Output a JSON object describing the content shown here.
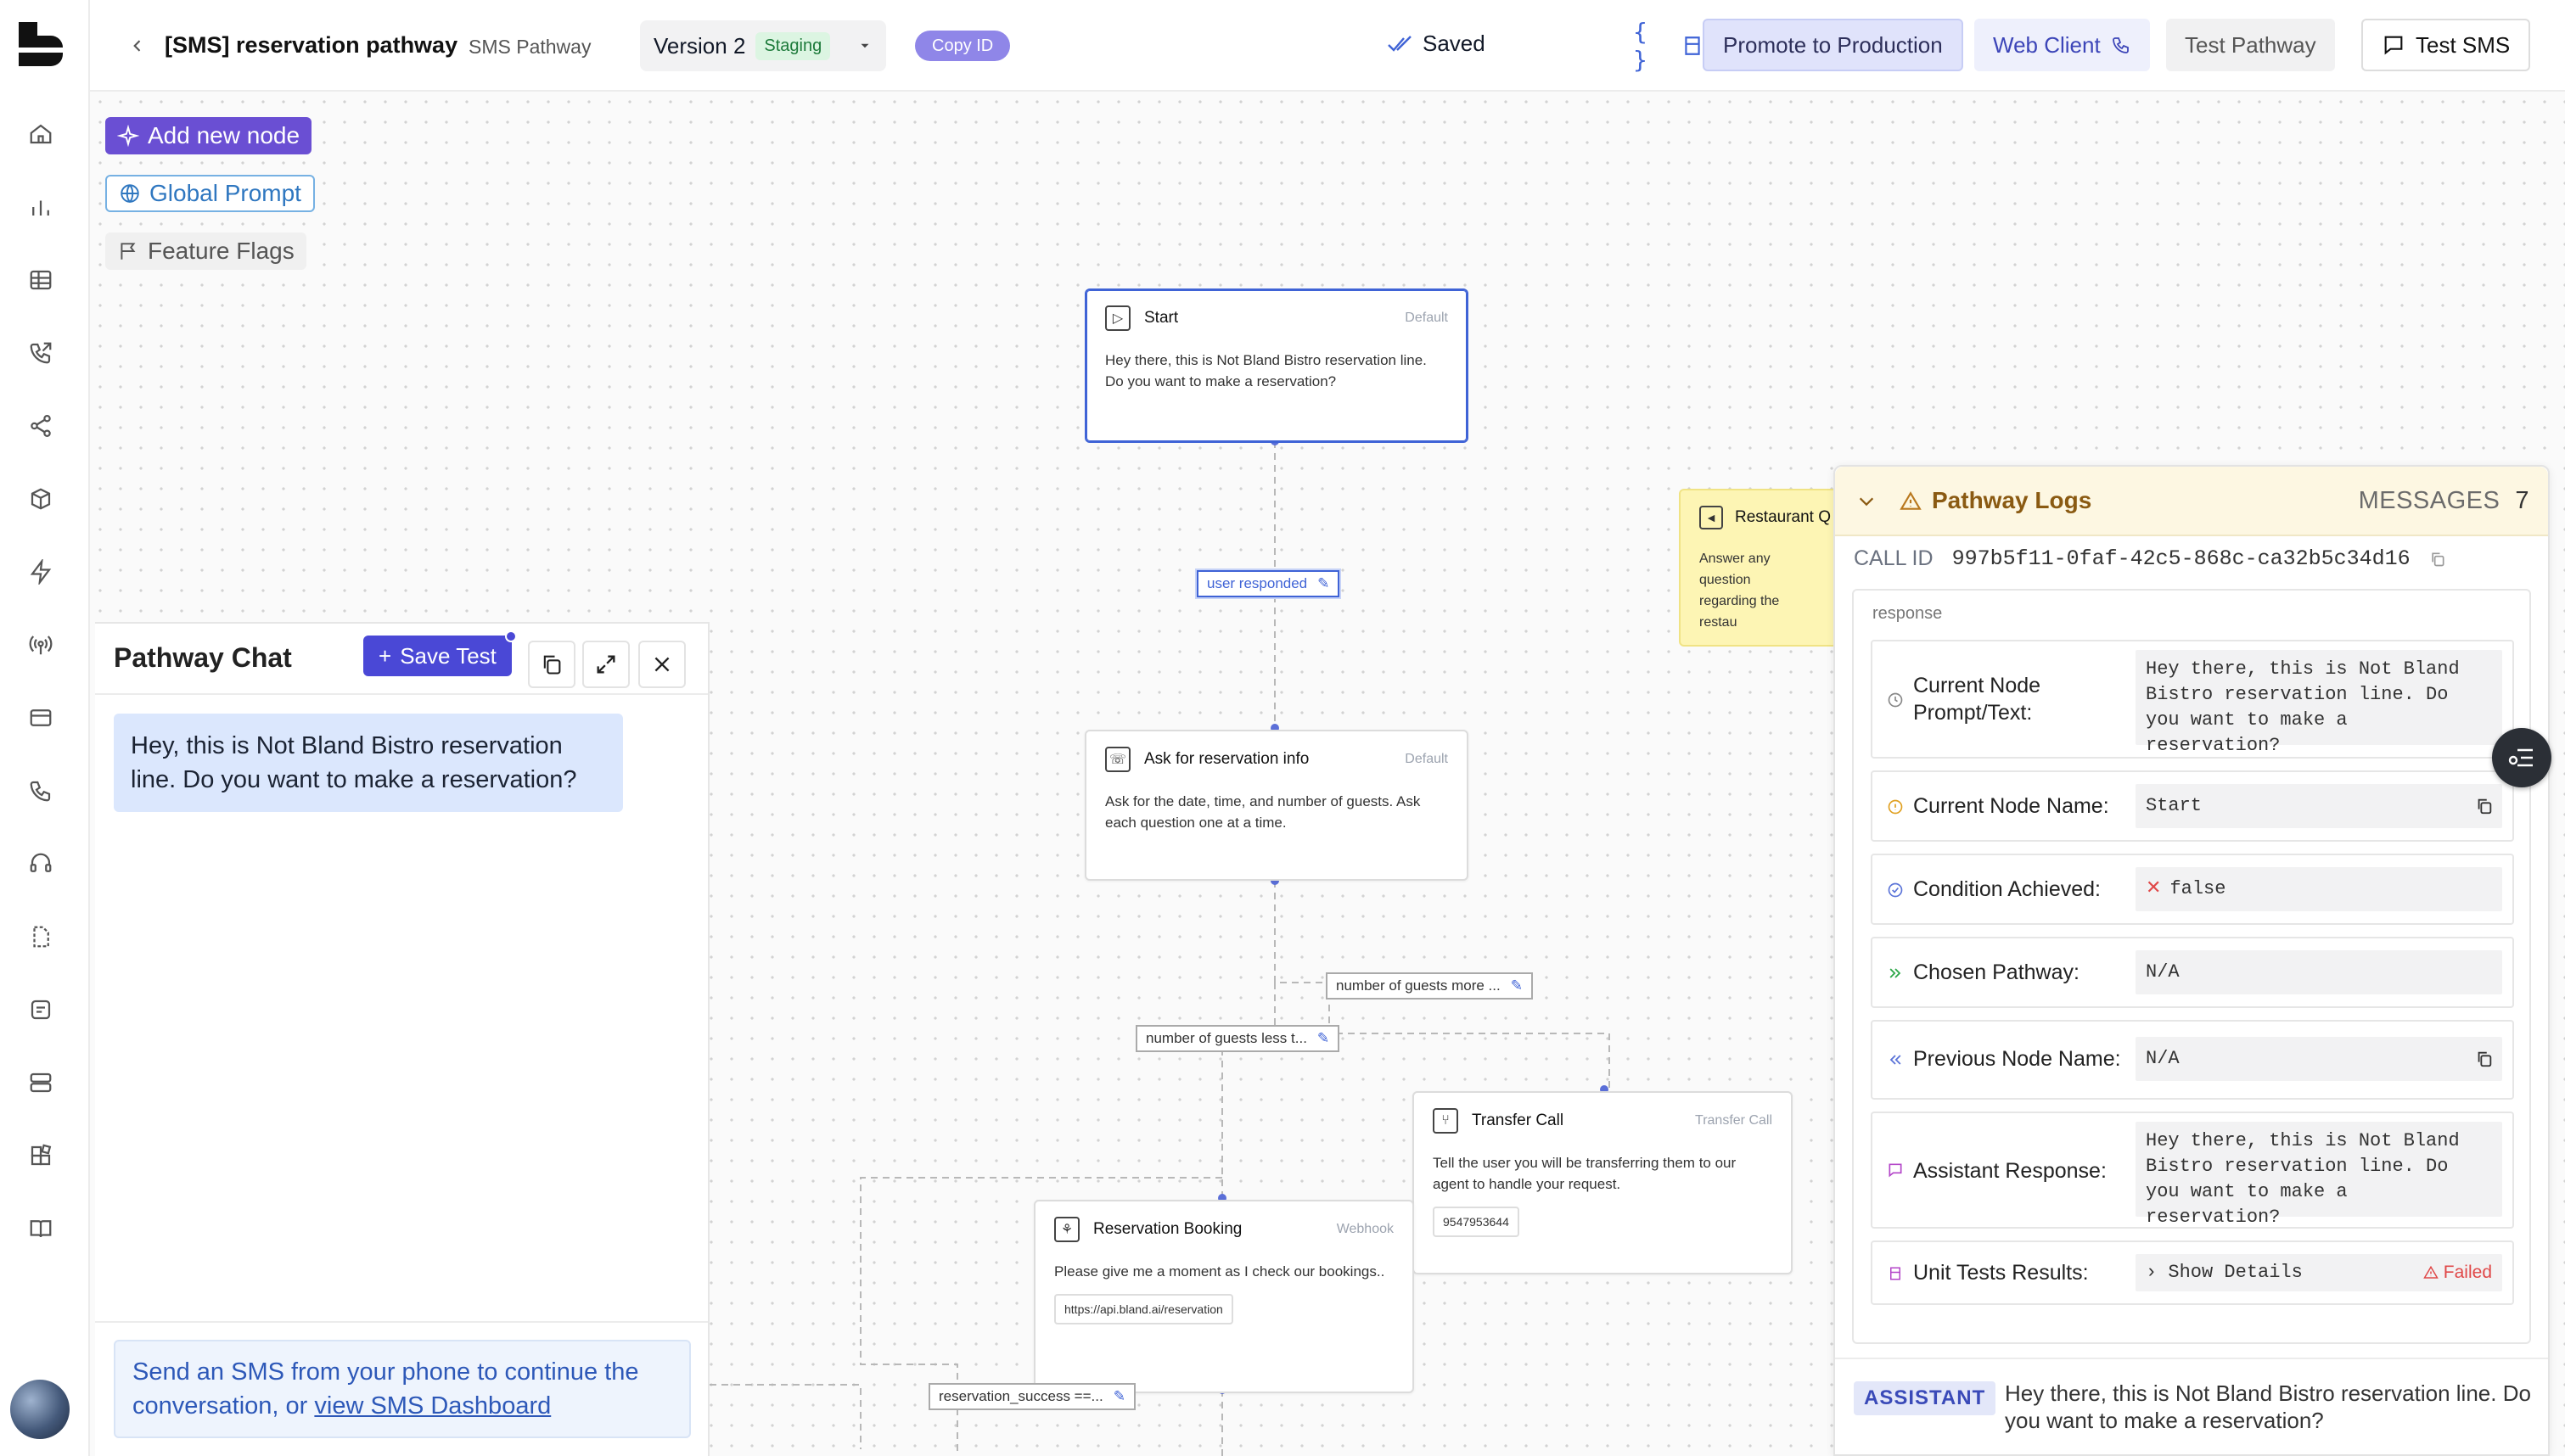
{
  "header": {
    "title": "[SMS] reservation pathway",
    "subtitle": "SMS Pathway",
    "version_label": "Version 2",
    "version_badge": "Staging",
    "copy_id": "Copy ID",
    "saved": "Saved",
    "promote": "Promote to Production",
    "web_client": "Web Client",
    "test_pathway": "Test Pathway",
    "test_sms": "Test SMS"
  },
  "canvas": {
    "add_node": "Add new node",
    "global_prompt": "Global Prompt",
    "feature_flags": "Feature Flags"
  },
  "nodes": {
    "start": {
      "title": "Start",
      "type": "Default",
      "body": "Hey there, this is Not Bland Bistro reservation line. Do you want to make a reservation?"
    },
    "ask": {
      "title": "Ask for reservation info",
      "type": "Default",
      "body": "Ask for the date, time, and number of guests. Ask each question one at a time."
    },
    "transfer": {
      "title": "Transfer Call",
      "type": "Transfer Call",
      "body": "Tell the user you will be transferring them to our agent to handle your request.",
      "chip": "9547953644"
    },
    "booking": {
      "title": "Reservation Booking",
      "type": "Webhook",
      "body": "Please give me a moment as I check our bookings..",
      "chip": "https://api.bland.ai/reservation"
    },
    "note": {
      "title": "Restaurant Q",
      "body": "Answer any question regarding the restau"
    }
  },
  "edges": {
    "user_responded": "user responded",
    "guests_more": "number of guests more ...",
    "guests_less": "number of guests less t...",
    "reservation_success": "reservation_success ==..."
  },
  "chat": {
    "title": "Pathway Chat",
    "save_test": "Save Test",
    "message": "Hey, this is Not Bland Bistro reservation line. Do you want to make a reservation?",
    "sms_note": "Send an SMS from your phone to continue the conversation, or ",
    "sms_link": "view SMS Dashboard"
  },
  "logs": {
    "title": "Pathway Logs",
    "messages_label": "MESSAGES",
    "messages_count": "7",
    "call_id_label": "CALL ID",
    "call_id": "997b5f11-0faf-42c5-868c-ca32b5c34d16",
    "response_label": "response",
    "rows": [
      {
        "label": "Current Node Prompt/Text:",
        "value": "Hey there, this is Not Bland Bistro reservation line. Do you want to make a reservation?"
      },
      {
        "label": "Current Node Name:",
        "value": "Start"
      },
      {
        "label": "Condition Achieved:",
        "value": "false"
      },
      {
        "label": "Chosen Pathway:",
        "value": "N/A"
      },
      {
        "label": "Previous Node Name:",
        "value": "N/A"
      },
      {
        "label": "Assistant Response:",
        "value": "Hey there, this is Not Bland Bistro reservation line. Do you want to make a reservation?"
      },
      {
        "label": "Unit Tests Results:",
        "value": "Show Details",
        "status": "Failed"
      }
    ],
    "assistant_tag": "ASSISTANT",
    "assistant_text": "Hey there, this is Not Bland Bistro reservation line. Do you want to make a reservation?"
  },
  "colors": {
    "accent": "#4a48d6",
    "selected": "#3f63d6",
    "logs_header": "#fdf7e2",
    "failed": "#e04848"
  },
  "icons": [
    "logo",
    "home-icon",
    "chart-icon",
    "table-icon",
    "phone-outgoing-icon",
    "share-icon",
    "cube-icon",
    "bolt-icon",
    "broadcast-icon",
    "card-icon",
    "phone-icon",
    "headset-icon",
    "document-icon",
    "message-icon",
    "server-icon",
    "blocks-icon",
    "book-icon"
  ]
}
